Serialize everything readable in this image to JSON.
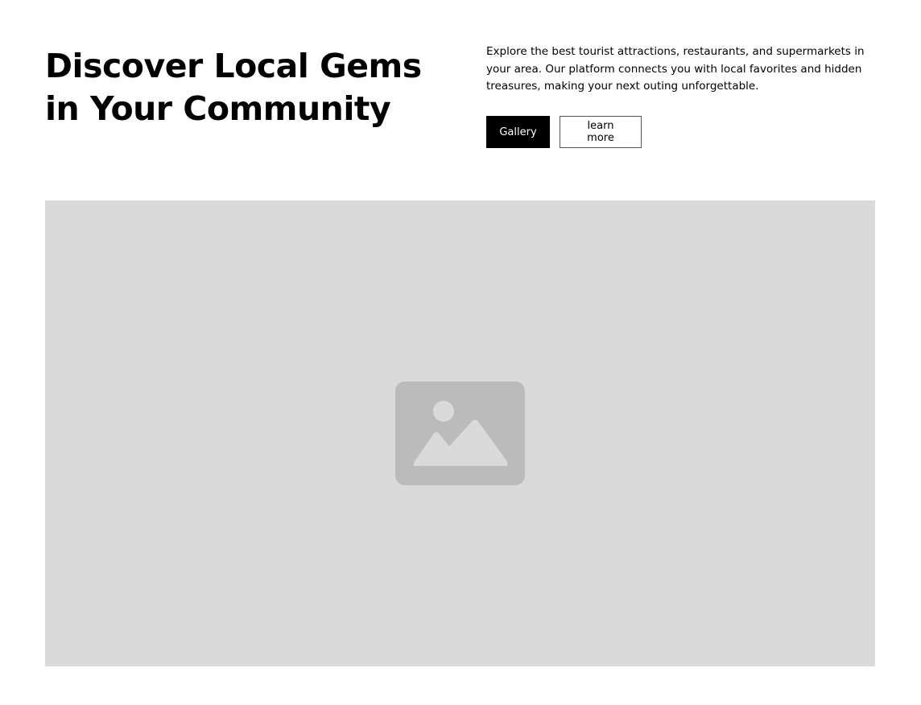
{
  "hero": {
    "title_line1": "Discover Local Gems",
    "title_line2": "in Your Community",
    "description": "Explore the best tourist attractions, restaurants, and supermarkets in your area. Our platform connects you with local favorites and hidden treasures, making your next outing unforgettable.",
    "primary_button_label": "Gallery",
    "secondary_button_label": "learn more",
    "image_icon": "image-placeholder-icon"
  },
  "colors": {
    "primary_button_bg": "#000000",
    "image_bg": "#dadada",
    "icon_fill": "#bbbbbb",
    "icon_detail": "#dadada"
  }
}
